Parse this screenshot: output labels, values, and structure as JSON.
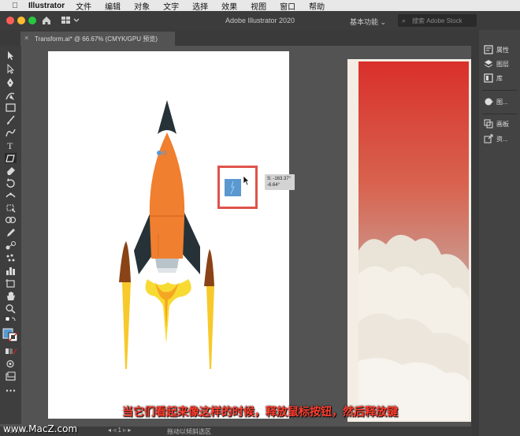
{
  "menubar": {
    "app_name": "Illustrator",
    "items": [
      "文件",
      "编辑",
      "对象",
      "文字",
      "选择",
      "效果",
      "视图",
      "窗口",
      "帮助"
    ]
  },
  "appbar": {
    "title": "Adobe Illustrator 2020",
    "workspace": "基本功能",
    "stock_placeholder": "搜索 Adobe Stock"
  },
  "document": {
    "tab_title": "Transform.ai* @ 66.67% (CMYK/GPU 预览)"
  },
  "right_panel": {
    "items": [
      "属性",
      "图层",
      "库",
      "图...",
      "画板",
      "资..."
    ]
  },
  "canvas": {
    "tooltip_line1": "S: -163.37°",
    "tooltip_line2": "-6.64°"
  },
  "statusbar": {
    "zoom": "66.67%",
    "status": "拖动以倾斜选区"
  },
  "subtitle": "当它们看起来像这样的时候，释放鼠标按钮，然后释放键",
  "watermark": "www.MacZ.com",
  "colors": {
    "rocket_body": "#f07f2f",
    "rocket_dark": "#263238",
    "fin_brown": "#8a4316",
    "flame_yellow": "#f7cf2a",
    "selection_red": "#e0524c",
    "subtitle_red": "#ff3f2f"
  }
}
